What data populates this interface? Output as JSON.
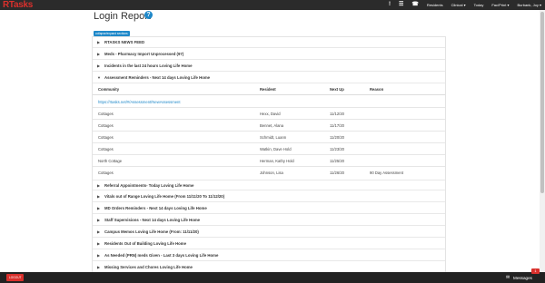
{
  "app": {
    "logo": "RTasks",
    "accent_color": "#d9302c",
    "link_color": "#1e88c9"
  },
  "topnav": {
    "icons": [
      "exclamation-icon",
      "list-icon",
      "phone-icon"
    ],
    "items": [
      "Residents",
      "Clinical",
      "Today",
      "Fac/Print",
      "Burbank, Joy"
    ],
    "carets": [
      "",
      "▾",
      "",
      "▾",
      "▾"
    ]
  },
  "page": {
    "title": "Login Report",
    "help_symbol": "?"
  },
  "collapse_pill": "collapse/expand sections",
  "sections_top": [
    {
      "chevron": "▶",
      "label": "RTASKS NEWS FEED"
    },
    {
      "chevron": "▶",
      "label": "Meds - Pharmacy Import Unprocessed (97)"
    },
    {
      "chevron": "▶",
      "label": "Incidents in the last 24 hours Loving Life Home"
    },
    {
      "chevron": "▼",
      "label": "Assessment Reminders - Next 14 days Loving Life Home"
    }
  ],
  "table": {
    "headers": [
      "Community",
      "Resident",
      "Next Up",
      "Reason"
    ],
    "link": "https://rtasks.net/#/Assessment/NewAssessment",
    "rows": [
      [
        "Cottages",
        "Hexx, David",
        "11/12/20",
        ""
      ],
      [
        "Cottages",
        "Bennet, Alana",
        "11/17/20",
        ""
      ],
      [
        "Cottages",
        "Schmidt, Luann",
        "11/20/20",
        ""
      ],
      [
        "Cottages",
        "Watkin, Dave Hold",
        "11/23/20",
        ""
      ],
      [
        "North Cottage",
        "Herman, Kathy Hold",
        "11/25/20",
        ""
      ],
      [
        "Cottages",
        "Johnson, Lisa",
        "11/26/20",
        "90 Day Assessment"
      ]
    ]
  },
  "sections_bottom": [
    {
      "chevron": "▶",
      "label": "Referral Appointments- Today Loving Life Home"
    },
    {
      "chevron": "▶",
      "label": "Vitals out of Range Loving Life Home (From 11/11/20 To 11/12/20)"
    },
    {
      "chevron": "▶",
      "label": "MD Orders Reminders - Next 14 days Loving Life Home"
    },
    {
      "chevron": "▶",
      "label": "Staff Supervisions - Next 14 days Loving Life Home"
    },
    {
      "chevron": "▶",
      "label": "Campus Memos Loving Life Home (From: 11/11/20)"
    },
    {
      "chevron": "▶",
      "label": "Residents Out of Building Loving Life Home"
    },
    {
      "chevron": "▶",
      "label": "As Needed (PRN) meds Given - Last 3 days Loving Life Home"
    },
    {
      "chevron": "▶",
      "label": "Missing Services and Chores Loving Life Home"
    }
  ],
  "footer": {
    "logout": "LOGOUT",
    "messages_label": "Messages",
    "messages_count": "1"
  }
}
